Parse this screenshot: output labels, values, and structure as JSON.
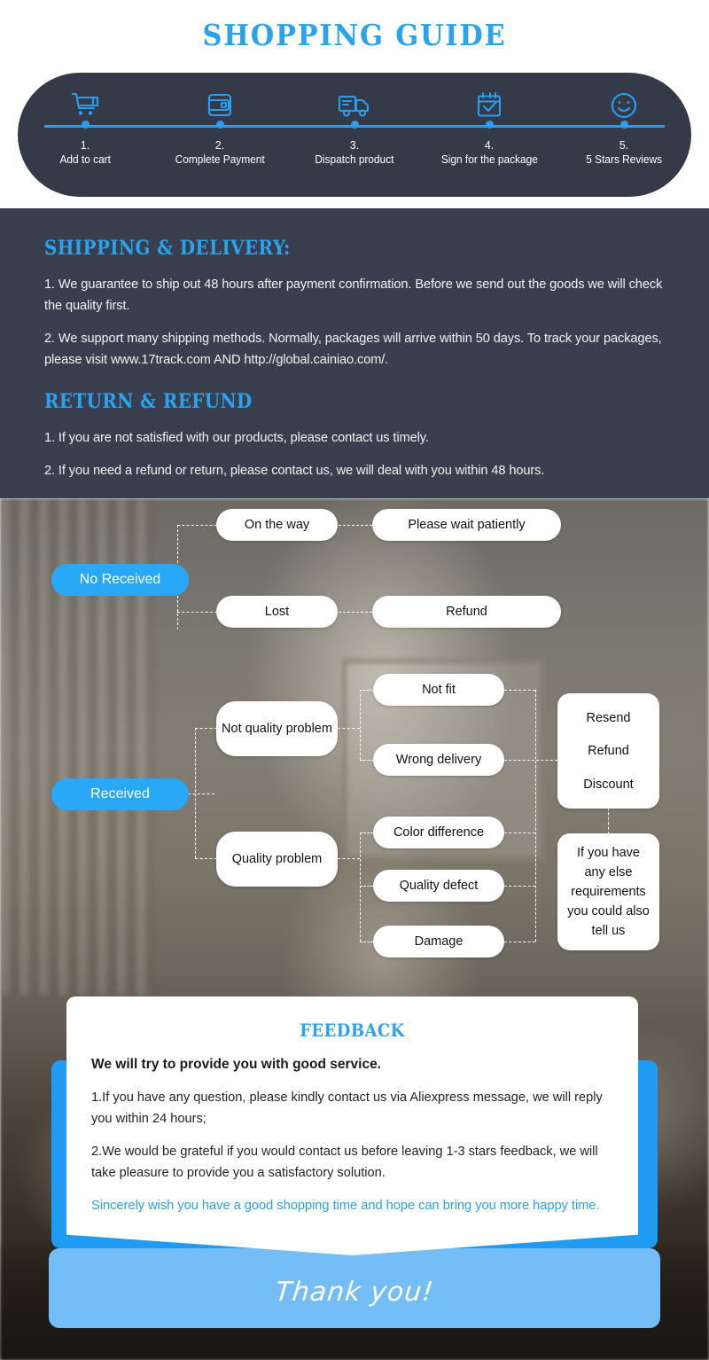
{
  "guide": {
    "title": "SHOPPING GUIDE",
    "steps": [
      {
        "num": "1.",
        "label": "Add to cart",
        "icon": "shopping-cart-icon"
      },
      {
        "num": "2.",
        "label": "Complete Payment",
        "icon": "wallet-icon"
      },
      {
        "num": "3.",
        "label": "Dispatch product",
        "icon": "delivery-truck-icon"
      },
      {
        "num": "4.",
        "label": "Sign for the package",
        "icon": "calendar-check-icon"
      },
      {
        "num": "5.",
        "label": "5 Stars Reviews",
        "icon": "smiley-face-icon"
      }
    ]
  },
  "policy": {
    "shipping_heading": "SHIPPING & DELIVERY:",
    "shipping_items": [
      "1. We guarantee to ship out 48 hours after payment confirmation. Before we send out the goods we will check the quality first.",
      "2. We support many shipping methods. Normally, packages will arrive within 50 days. To track your packages, please visit www.17track.com AND http://global.cainiao.com/."
    ],
    "return_heading": "RETURN & REFUND",
    "return_items": [
      "1. If you are not satisfied with our products, please contact us timely.",
      "2. If you need a refund or return, please contact us, we will deal with you within 48 hours."
    ]
  },
  "flow": {
    "no_received": "No Received",
    "received": "Received",
    "on_the_way": "On the way",
    "please_wait": "Please wait patiently",
    "lost": "Lost",
    "refund": "Refund",
    "not_quality_problem": "Not quality problem",
    "quality_problem": "Quality problem",
    "not_fit": "Not fit",
    "wrong_delivery": "Wrong delivery",
    "color_difference": "Color difference",
    "quality_defect": "Quality defect",
    "damage": "Damage",
    "resolution": "Resend\n\nRefund\n\nDiscount",
    "resolution_1": "Resend",
    "resolution_2": "Refund",
    "resolution_3": "Discount",
    "else_note": "If you have any else requirements you could also tell us"
  },
  "feedback": {
    "title": "FEEDBACK",
    "lead": "We will try to provide you with good service.",
    "p1": "1.If you have any question, please kindly contact us via Aliexpress message, we will reply you within 24 hours;",
    "p2": "2.We would be grateful if you would contact us before leaving 1-3 stars feedback, we will take pleasure to provide you a satisfactory solution.",
    "p3": "Sincerely wish you have a good shopping time and hope can bring you more happy time.",
    "thanks": "Thank you!"
  },
  "colors": {
    "accent_blue": "#29a3ee",
    "bright_blue": "#1f9bf4",
    "light_blue": "#74bdf7",
    "dark_panel": "#3a3f4f",
    "pill_dark": "#353a49"
  }
}
